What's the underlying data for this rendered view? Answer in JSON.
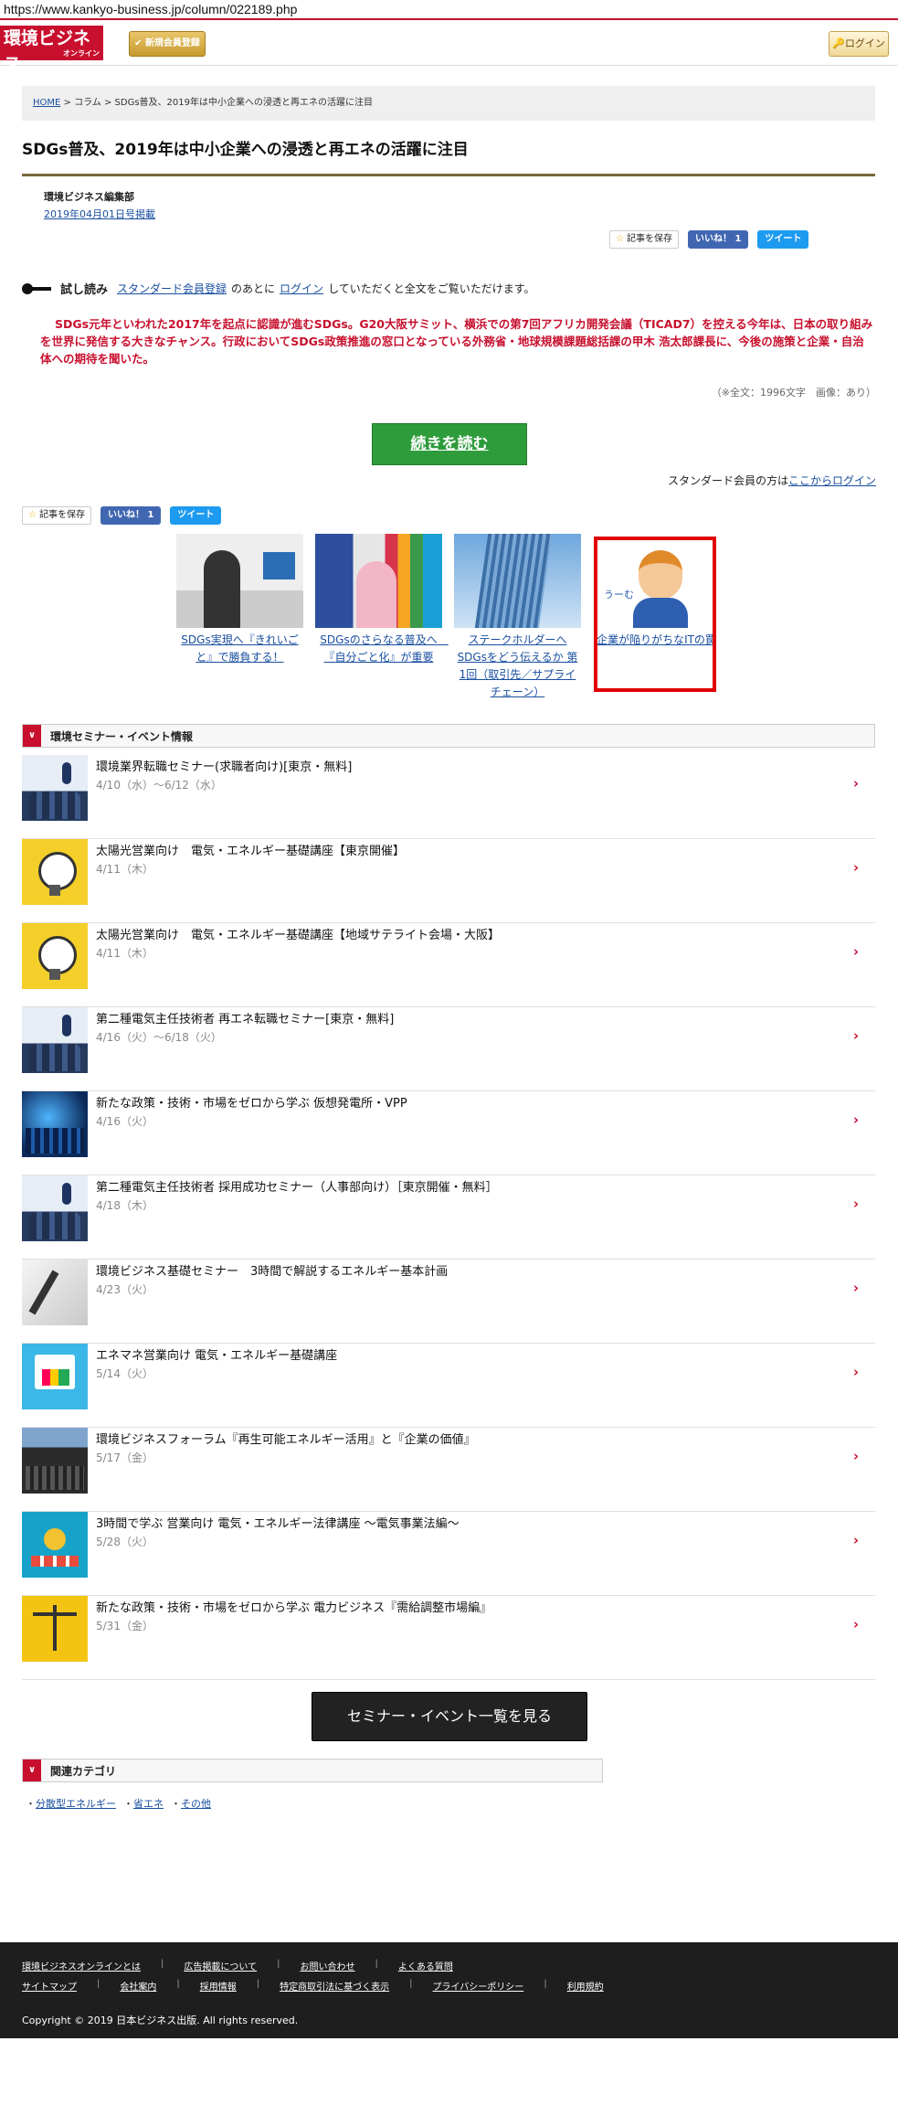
{
  "url": "https://www.kankyo-business.jp/column/022189.php",
  "header": {
    "logo_main": "環境ビジネス",
    "logo_sub": "オンライン",
    "register_label": "新規会員登録",
    "login_label": "ログイン"
  },
  "breadcrumb": {
    "home": "HOME",
    "sep": " > ",
    "column": "コラム",
    "current": "SDGs普及、2019年は中小企業への浸透と再エネの活躍に注目"
  },
  "article": {
    "title": "SDGs普及、2019年は中小企業への浸透と再エネの活躍に注目",
    "author": "環境ビジネス編集部",
    "date": "2019年04月01日号掲載",
    "trial_label": "試し読み",
    "trial_link": "スタンダード会員登録",
    "trial_mid": "のあとに",
    "trial_login": "ログイン",
    "trial_end": "していただくと全文をご覧いただけます。",
    "lead": "SDGs元年といわれた2017年を起点に認識が進むSDGs。G20大阪サミット、横浜での第7回アフリカ開発会議（TICAD7）を控える今年は、日本の取り組みを世界に発信する大きなチャンス。行政においてSDGs政策推進の窓口となっている外務省・地球規模課題総括課の甲木 浩太郎課長に、今後の施策と企業・自治体への期待を聞いた。",
    "char_count": "（※全文：1996文字　画像：あり）",
    "read_more": "続きを読む",
    "std_text": "スタンダード会員の方は",
    "std_link": "ここからログイン"
  },
  "share": {
    "save": "記事を保存",
    "like": "いいね！ 1",
    "tweet": "ツイート"
  },
  "related": [
    {
      "caption": "SDGs実現へ『きれいごと』で勝負する！",
      "img": "man-interview"
    },
    {
      "caption": "SDGsのさらなる普及へ　『自分ごと化』が重要",
      "img": "woman-sdgs"
    },
    {
      "caption": "ステークホルダーへSDGsをどう伝えるか 第1回（取引先／サプライチェーン）",
      "img": "building"
    },
    {
      "caption": "企業が陥りがちなITの罠",
      "img": "worried-man",
      "bubble": "うーむ"
    }
  ],
  "events_section": {
    "title": "環境セミナー・イベント情報",
    "items": [
      {
        "title": "環境業界転職セミナー(求職者向け)[東京・無料]",
        "date": "4/10（水）～6/12（水）",
        "img": "seminar"
      },
      {
        "title": "太陽光営業向け　電気・エネルギー基礎講座【東京開催】",
        "date": "4/11（木）",
        "img": "solar"
      },
      {
        "title": "太陽光営業向け　電気・エネルギー基礎講座【地域サテライト会場・大阪】",
        "date": "4/11（木）",
        "img": "solar"
      },
      {
        "title": "第二種電気主任技術者 再エネ転職セミナー[東京・無料]",
        "date": "4/16（火）～6/18（火）",
        "img": "seminar"
      },
      {
        "title": "新たな政策・技術・市場をゼロから学ぶ 仮想発電所・VPP",
        "date": "4/16（火）",
        "img": "city"
      },
      {
        "title": "第二種電気主任技術者 採用成功セミナー（人事部向け）［東京開催・無料］",
        "date": "4/18（木）",
        "img": "seminar"
      },
      {
        "title": "環境ビジネス基礎セミナー　3時間で解説するエネルギー基本計画",
        "date": "4/23（火）",
        "img": "pen"
      },
      {
        "title": "エネマネ営業向け 電気・エネルギー基礎講座",
        "date": "5/14（火）",
        "img": "chart"
      },
      {
        "title": "環境ビジネスフォーラム『再生可能エネルギー活用』と『企業の価値』",
        "date": "5/17（金）",
        "img": "forum"
      },
      {
        "title": "3時間で学ぶ 営業向け 電気・エネルギー法律講座 ～電気事業法編～",
        "date": "5/28（火）",
        "img": "law"
      },
      {
        "title": "新たな政策・技術・市場をゼロから学ぶ 電力ビジネス『需給調整市場編』",
        "date": "5/31（金）",
        "img": "scale"
      }
    ],
    "all_button": "セミナー・イベント一覧を見る"
  },
  "categories": {
    "title": "関連カテゴリ",
    "items": [
      "分散型エネルギー",
      "省エネ",
      "その他"
    ]
  },
  "footer": {
    "row1": [
      "環境ビジネスオンラインとは",
      "広告掲載について",
      "お問い合わせ",
      "よくある質問"
    ],
    "row2": [
      "サイトマップ",
      "会社案内",
      "採用情報",
      "特定商取引法に基づく表示",
      "プライバシーポリシー",
      "利用規約"
    ],
    "copyright": "Copyright © 2019 日本ビジネス出版. All rights reserved."
  },
  "colors": {
    "brand_red": "#c8102e",
    "cta_green": "#2f9c3c",
    "facebook": "#4267b2",
    "twitter": "#1d9bf0"
  }
}
